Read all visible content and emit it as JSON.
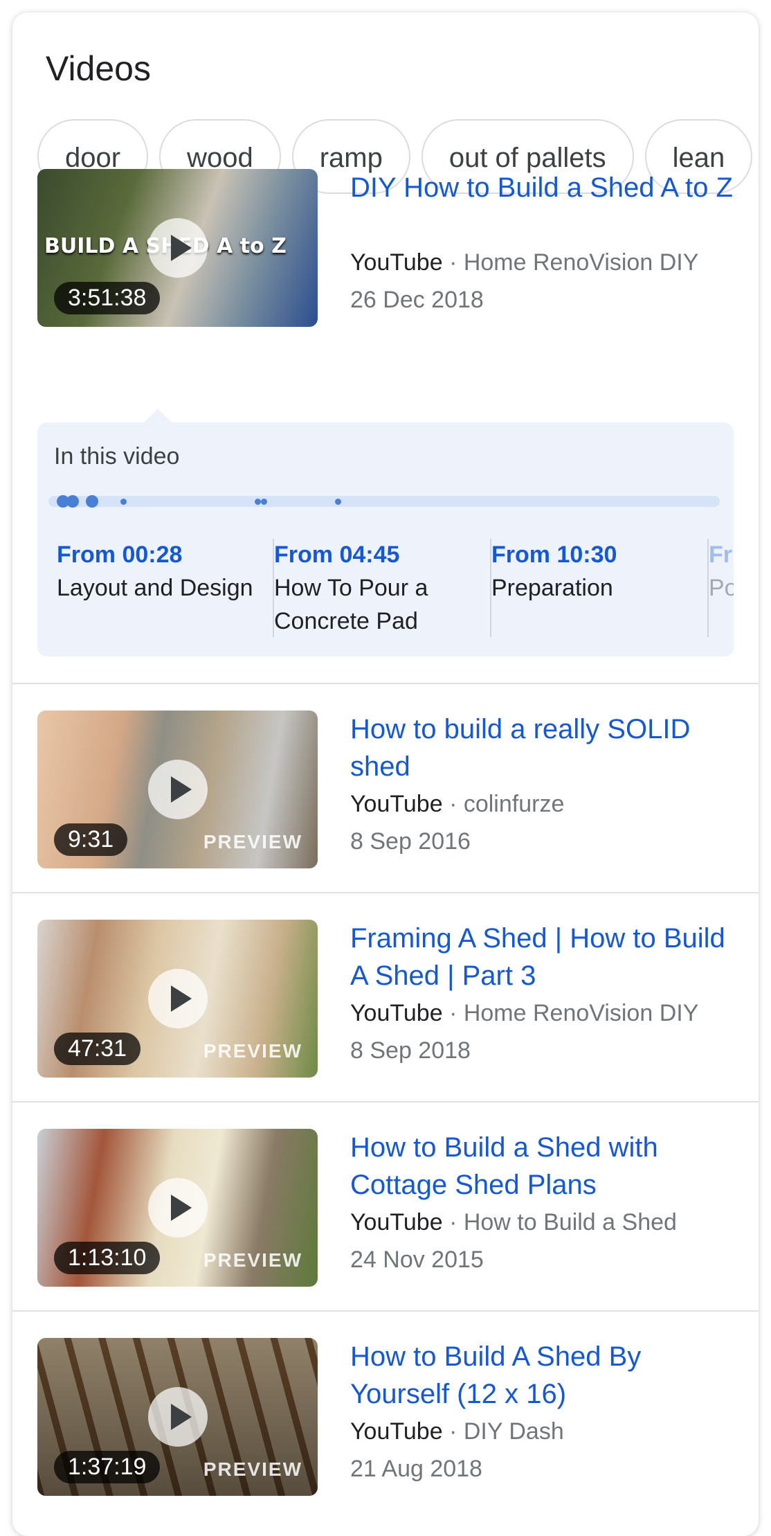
{
  "heading": "Videos",
  "chips": [
    "door",
    "wood",
    "ramp",
    "out of pallets",
    "lean"
  ],
  "videos": [
    {
      "title": "DIY How to Build a Shed A to Z",
      "source": "YouTube",
      "channel": "Home RenoVision DIY",
      "date": "26 Dec 2018",
      "duration": "3:51:38",
      "preview": "",
      "thumb_text": "BUILD A SHED A to Z"
    },
    {
      "title": "How to build a really SOLID shed",
      "source": "YouTube",
      "channel": "colinfurze",
      "date": "8 Sep 2016",
      "duration": "9:31",
      "preview": "PREVIEW"
    },
    {
      "title": "Framing A Shed | How to Build A Shed | Part 3",
      "source": "YouTube",
      "channel": "Home RenoVision DIY",
      "date": "8 Sep 2018",
      "duration": "47:31",
      "preview": "PREVIEW"
    },
    {
      "title": "How to Build a Shed with Cottage Shed Plans",
      "source": "YouTube",
      "channel": "How to Build a Shed",
      "date": "24 Nov 2015",
      "duration": "1:13:10",
      "preview": "PREVIEW"
    },
    {
      "title": "How to Build A Shed By Yourself (12 x 16)",
      "source": "YouTube",
      "channel": "DIY Dash",
      "date": "21 Aug 2018",
      "duration": "1:37:19",
      "preview": "PREVIEW"
    }
  ],
  "in_this_video": {
    "label": "In this video",
    "chapters": [
      {
        "time": "From 00:28",
        "name": "Layout and Design"
      },
      {
        "time": "From 04:45",
        "name": "How To Pour a Concrete Pad"
      },
      {
        "time": "From 10:30",
        "name": "Preparation"
      },
      {
        "time": "Fr",
        "name": "Po"
      }
    ]
  },
  "separator": "·",
  "colors": {
    "link": "#1558d6",
    "chapters_bg": "#eef3fb",
    "track": "#d6e2f8",
    "marker": "#4a7fd6"
  }
}
